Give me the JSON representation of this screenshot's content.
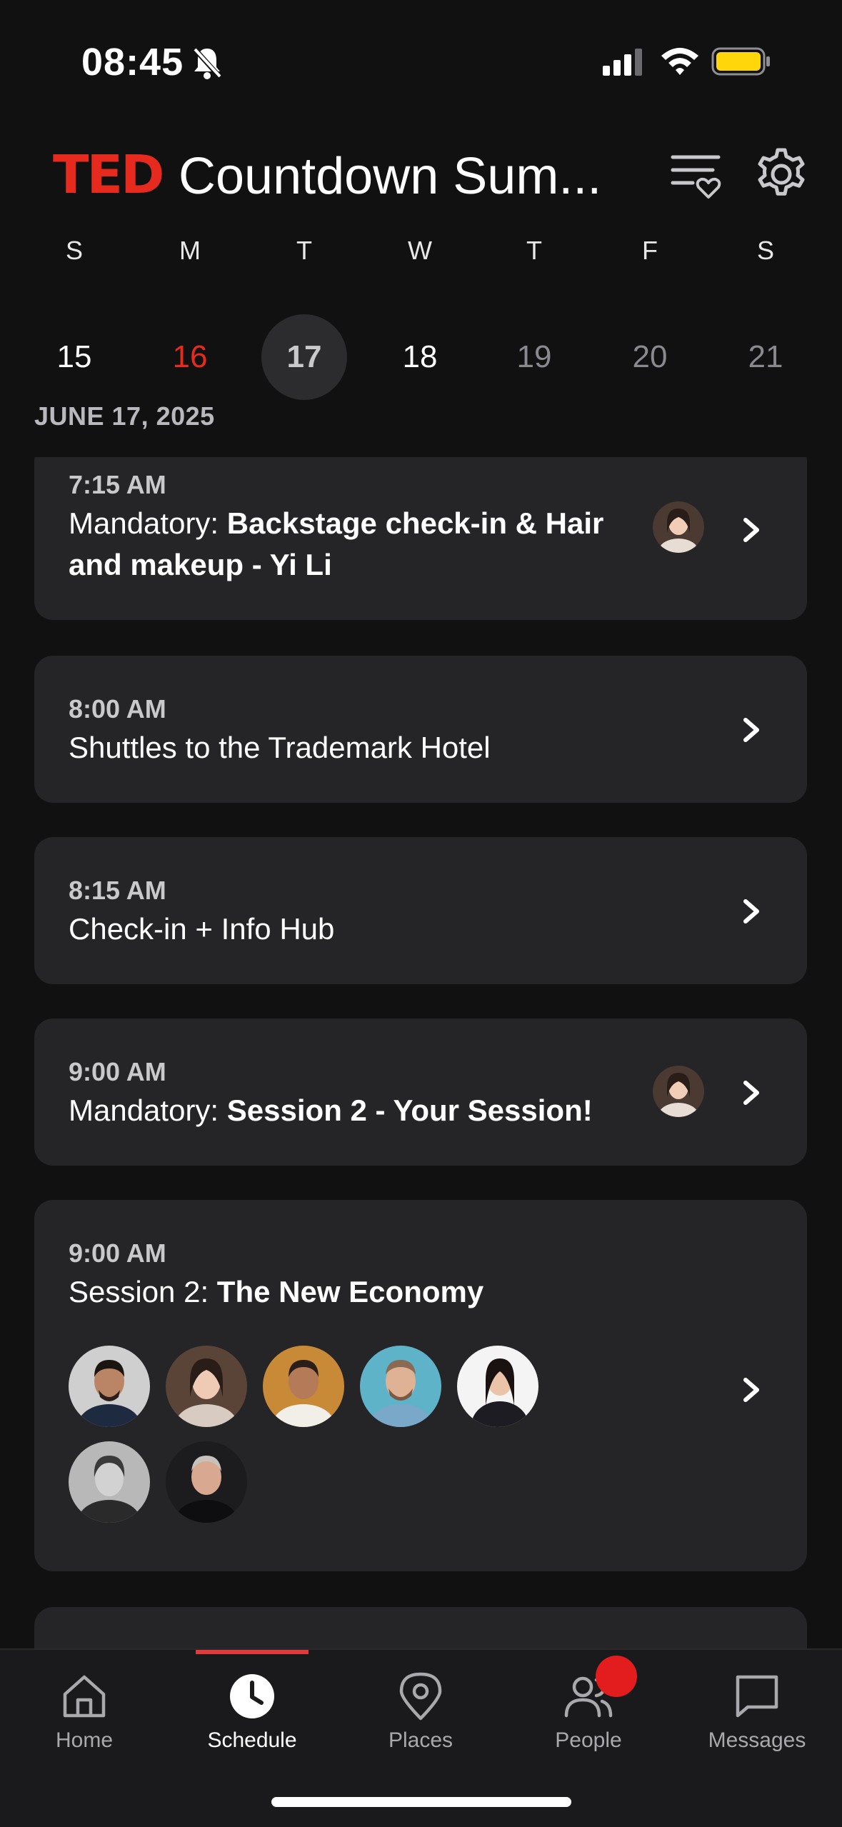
{
  "status_bar": {
    "time": "08:45"
  },
  "header": {
    "logo": "TED",
    "title": "Countdown Sum..."
  },
  "week": {
    "days_of_week": [
      "S",
      "M",
      "T",
      "W",
      "T",
      "F",
      "S"
    ],
    "dates": [
      "15",
      "16",
      "17",
      "18",
      "19",
      "20",
      "21"
    ],
    "today_index": 1,
    "selected_index": 2
  },
  "date_label": "JUNE 17, 2025",
  "events": [
    {
      "time": "7:15 AM",
      "prefix": "Mandatory: ",
      "title_line1": "Backstage check-in & Hair",
      "title_line2": "and makeup - Yi Li"
    },
    {
      "time": "8:00 AM",
      "title": "Shuttles to the Trademark Hotel"
    },
    {
      "time": "8:15 AM",
      "title": "Check-in + Info Hub"
    },
    {
      "time": "9:00 AM",
      "prefix": "Mandatory: ",
      "title": "Session 2 - Your Session!"
    },
    {
      "time": "9:00 AM",
      "prefix": "Session 2: ",
      "title": "The New Economy"
    }
  ],
  "tabs": [
    {
      "label": "Home",
      "icon": "home-icon"
    },
    {
      "label": "Schedule",
      "icon": "clock-icon",
      "active": true
    },
    {
      "label": "Places",
      "icon": "map-pin-icon"
    },
    {
      "label": "People",
      "icon": "people-icon",
      "badge": true
    },
    {
      "label": "Messages",
      "icon": "message-icon"
    }
  ],
  "colors": {
    "accent": "#e62b1e",
    "card": "#252427",
    "background": "#111112"
  }
}
